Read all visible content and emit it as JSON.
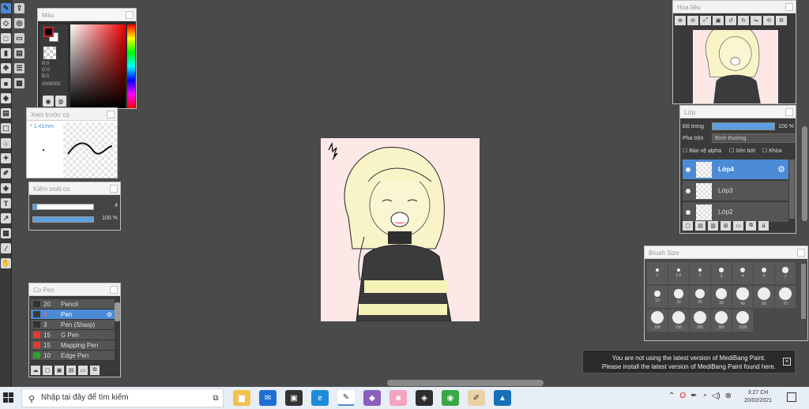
{
  "color_panel": {
    "title": "Màu",
    "rgb": "R:0\nG:0\nB:0",
    "hex": "#000000"
  },
  "preview_panel": {
    "title": "Xem trước cọ",
    "size": "1.41mm"
  },
  "control_panel": {
    "title": "Kiểm soát cọ",
    "size_value": "4",
    "opacity_value": "100 %",
    "opacity_fraction": 1.0
  },
  "pen_panel": {
    "title": "Cọ Pen",
    "items": [
      {
        "size": "20",
        "name": "Pencil",
        "color": "#333333",
        "active": false
      },
      {
        "size": "4",
        "name": "Pen",
        "color": "#3a3a3a",
        "active": true
      },
      {
        "size": "3",
        "name": "Pen (Sharp)",
        "color": "#333333",
        "active": false
      },
      {
        "size": "15",
        "name": "G Pen",
        "color": "#e53935",
        "active": false
      },
      {
        "size": "15",
        "name": "Mapping Pen",
        "color": "#e53935",
        "active": false
      },
      {
        "size": "10",
        "name": "Edge Pen",
        "color": "#2e9e2e",
        "active": false
      }
    ]
  },
  "navigator": {
    "title": "Hoa tiêu"
  },
  "layer_panel": {
    "title": "Lớp",
    "opacity_label": "Độ trong",
    "opacity_value": "100 %",
    "blend_label": "Pha trộn",
    "blend_value": "Bình thường",
    "check_alpha": "Bảo vệ alpha",
    "check_clip": "Xén bớt",
    "check_lock": "Khóa",
    "layers": [
      {
        "name": "Lớp4",
        "active": true
      },
      {
        "name": "Lớp3",
        "active": false
      },
      {
        "name": "Lớp2",
        "active": false
      }
    ]
  },
  "size_panel": {
    "title": "Brush Size",
    "sizes": [
      "1",
      "1.5",
      "2",
      "3",
      "4",
      "5",
      "7",
      "10",
      "20",
      "25",
      "30",
      "40",
      "50",
      "70",
      "100",
      "150",
      "200",
      "300",
      "1000"
    ]
  },
  "notice": {
    "line1": "You are not using the latest version of MediBang Paint.",
    "line2": "Please install the latest version of MediBang Paint found here."
  },
  "taskbar": {
    "search_placeholder": "Nhập tại đây để tìm kiếm",
    "time": "3:27 CH",
    "date": "20/02/2021"
  }
}
